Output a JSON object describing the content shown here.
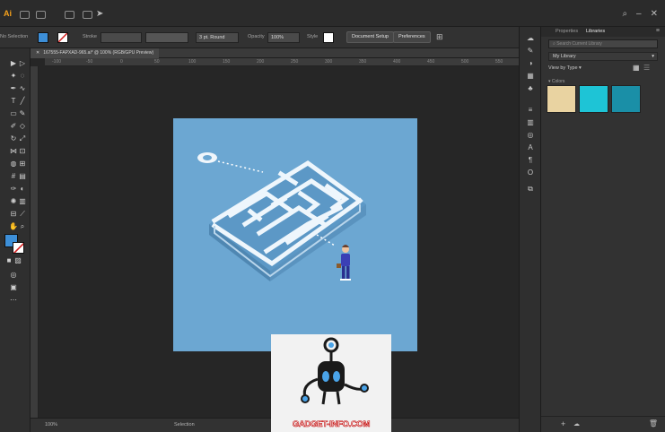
{
  "app": {
    "logo": "Ai"
  },
  "control_bar": {
    "selection_label": "No Selection",
    "stroke_label": "Stroke",
    "brush_value": "3 pt. Round",
    "opacity_label": "Opacity",
    "opacity_value": "100%",
    "style_label": "Style",
    "document_setup": "Document Setup",
    "preferences": "Preferences",
    "fill_color": "#3d8fd8",
    "stroke_color": "#d21e1e"
  },
  "document": {
    "tab_title": "167555-FAPXAD-965.ai* @ 100% (RGB/GPU Preview)"
  },
  "ruler": {
    "ticks": [
      "-100",
      "-50",
      "0",
      "50",
      "100",
      "150",
      "200",
      "250",
      "300",
      "350",
      "400",
      "450",
      "500",
      "550"
    ]
  },
  "status": {
    "zoom": "100%",
    "tool": "Selection"
  },
  "panel": {
    "tabs": [
      "Properties",
      "Libraries"
    ],
    "active_tab": "Libraries",
    "search_placeholder": "Search Current Library",
    "library_name": "My Library",
    "view_label": "View by Type",
    "group_label": "Colors",
    "colors": [
      "#e9d3a1",
      "#1ec4d6",
      "#1a8fa7"
    ]
  },
  "watermark": {
    "text": "GADGET-INFO.COM"
  }
}
